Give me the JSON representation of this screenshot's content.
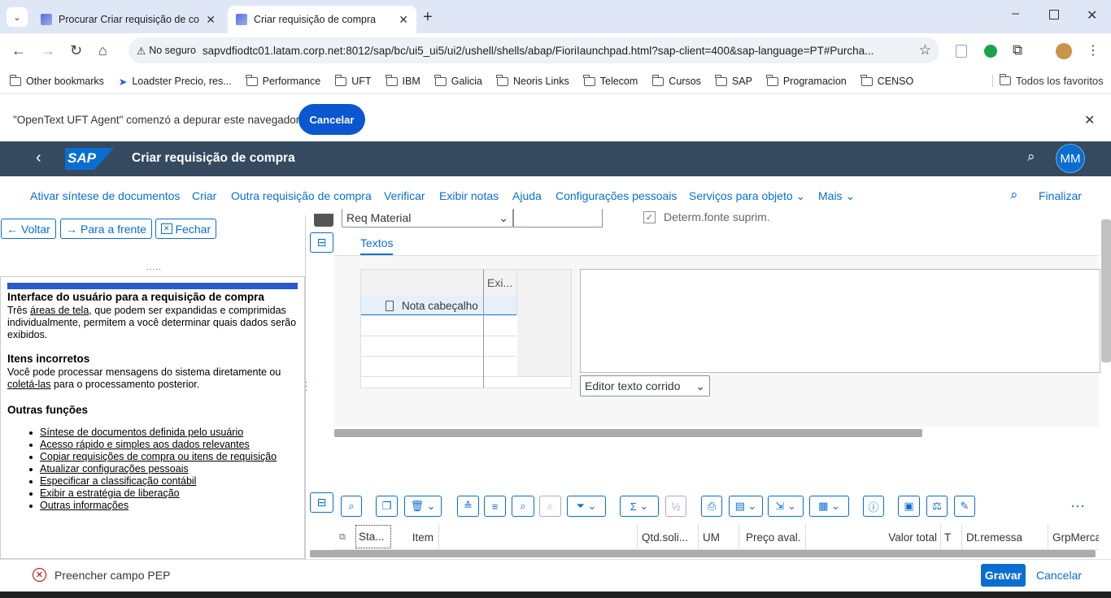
{
  "browser": {
    "tabs": [
      {
        "title": "Procurar Criar requisição de compra"
      },
      {
        "title": "Criar requisição de compra"
      }
    ],
    "address": {
      "security_label": "No seguro",
      "url": "sapvdfiodtc01.latam.corp.net:8012/sap/bc/ui5_ui5/ui2/ushell/shells/abap/FioriIaunchpad.html?sap-client=400&sap-language=PT#Purcha..."
    },
    "bookmarks": [
      {
        "label": "Other bookmarks"
      },
      {
        "label": "Loadster Precio, res..."
      },
      {
        "label": "Performance"
      },
      {
        "label": "UFT"
      },
      {
        "label": "IBM"
      },
      {
        "label": "Galicia"
      },
      {
        "label": "Neoris Links"
      },
      {
        "label": "Telecom"
      },
      {
        "label": "Cursos"
      },
      {
        "label": "SAP"
      },
      {
        "label": "Programacion"
      },
      {
        "label": "CENSO"
      }
    ],
    "all_bookmarks": "Todos los favoritos",
    "infobar": {
      "text": "\"OpenText UFT Agent\" comenzó a depurar este navegador",
      "cancel": "Cancelar"
    }
  },
  "shell": {
    "logo": "SAP",
    "title": "Criar requisição de compra",
    "avatar": "MM"
  },
  "toolbar": {
    "items": [
      "Ativar síntese de documentos",
      "Criar",
      "Outra requisição de compra",
      "Verificar",
      "Exibir notas",
      "Ajuda",
      "Configurações pessoais",
      "Serviços para objeto",
      "Mais"
    ],
    "finalize": "Finalizar"
  },
  "left": {
    "back": "Voltar",
    "forward": "Para a frente",
    "close": "Fechar",
    "help": {
      "h1": "Interface do usuário para a requisição de compra",
      "p1a": "Três ",
      "p1link": "áreas de tela",
      "p1b": ", que podem ser expandidas e comprimidas individualmente, permitem a você determinar quais dados serão exibidos.",
      "h2": "Itens incorretos",
      "p2a": "Você pode processar mensagens do sistema diretamente ou ",
      "p2link": "coletá-las",
      "p2b": " para o processamento posterior.",
      "h3": "Outras funções",
      "links": [
        "Síntese de documentos definida pelo usuário",
        "Acesso rápido e simples aos dados relevantes",
        "Copiar requisições de compra ou itens de requisição",
        "Atualizar configurações pessoais",
        "Especificar a classificação contábil",
        "Exibir a estratégia de liberação",
        "Outras informações"
      ]
    }
  },
  "header_area": {
    "doc_type": "Req Material",
    "checkbox_label": "Determ.fonte suprim.",
    "tab": "Textos",
    "grid_col": "Exi...",
    "grid_row": "Nota cabeçalho",
    "editor_mode": "Editor texto corrido"
  },
  "items_table": {
    "columns": [
      "Sta...",
      "Item",
      "Qtd.soli...",
      "UM",
      "Preço aval.",
      "Valor total",
      "T",
      "Dt.remessa",
      "GrpMerca"
    ]
  },
  "footer": {
    "message": "Preencher campo PEP",
    "save": "Gravar",
    "cancel": "Cancelar"
  }
}
